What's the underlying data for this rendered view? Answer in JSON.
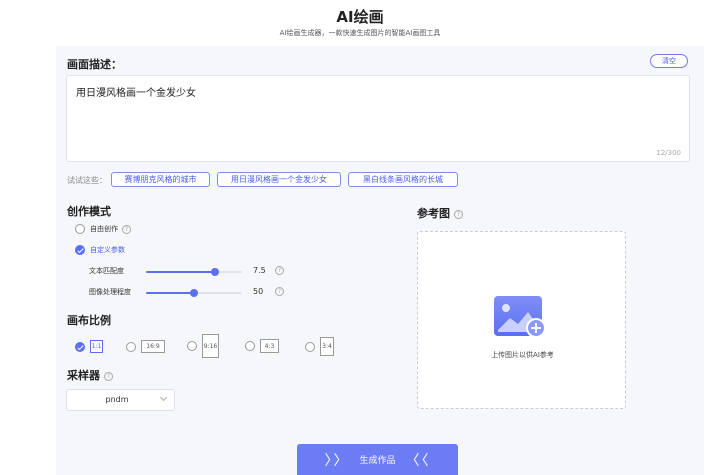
{
  "header": {
    "title": "AI绘画",
    "subtitle": "AI绘画生成器，一款快速生成图片的智能AI画图工具"
  },
  "description": {
    "label": "画面描述：",
    "clear_label": "清空",
    "value": "用日漫风格画一个金发少女",
    "count": "12/300"
  },
  "try": {
    "label": "试试这些：",
    "chips": [
      "赛博朋克风格的城市",
      "用日漫风格画一个金发少女",
      "黑白线条画风格的长城"
    ]
  },
  "mode": {
    "title": "创作模式",
    "options": [
      {
        "label": "自由创作",
        "checked": false
      },
      {
        "label": "自定义参数",
        "checked": true
      }
    ],
    "sliders": [
      {
        "label": "文本匹配度",
        "value": "7.5",
        "fraction": 0.72
      },
      {
        "label": "图像处理程度",
        "value": "50",
        "fraction": 0.5
      }
    ]
  },
  "ratio": {
    "title": "画布比例",
    "options": [
      {
        "label": "1:1",
        "checked": true
      },
      {
        "label": "16:9",
        "checked": false
      },
      {
        "label": "9:16",
        "checked": false
      },
      {
        "label": "4:3",
        "checked": false
      },
      {
        "label": "3:4",
        "checked": false
      }
    ]
  },
  "sampler": {
    "title": "采样器",
    "value": "pndm"
  },
  "reference": {
    "title": "参考图",
    "upload_text": "上传图片以供AI参考"
  },
  "generate": {
    "label": "生成作品",
    "left_arrows": "〉〉",
    "right_arrows": "〈〈"
  },
  "colors": {
    "accent": "#5b6ff0",
    "panel": "#f6f7fa"
  }
}
